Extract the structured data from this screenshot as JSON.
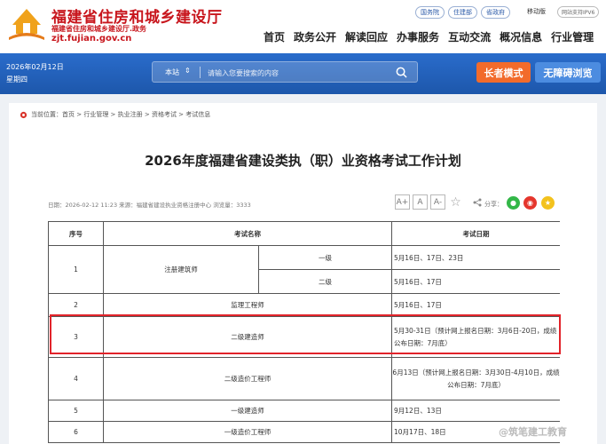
{
  "header": {
    "title": "福建省住房和城乡建设厅",
    "subtitle": "福建省住房和城乡建设厅.政务",
    "domain": "zjt.fujian.gov.cn",
    "top_links": [
      "国务院",
      "住建部",
      "省政府"
    ],
    "mobile": "移动版",
    "ipv6": "网站支持IPV6",
    "nav": [
      "首页",
      "政务公开",
      "解读回应",
      "办事服务",
      "互动交流",
      "概况信息",
      "行业管理"
    ]
  },
  "banner": {
    "date": "2026年02月12日",
    "weekday": "星期四",
    "search_scope": "本站",
    "search_placeholder": "请输入您要搜索的内容",
    "elder_mode": "长者模式",
    "accessible": "无障碍浏览"
  },
  "breadcrumb": "当前位置：首页 > 行业管理 > 执业注册 > 资格考试 > 考试信息",
  "article": {
    "title": "2026年度福建省建设类执（职）业资格考试工作计划",
    "meta": "日期：2026-02-12 11:23    来源：福建省建设执业资格注册中心    浏览量：3333",
    "font_buttons": [
      "A+",
      "A",
      "A-"
    ],
    "share_label": "分享："
  },
  "table": {
    "headers": [
      "序号",
      "考试名称",
      "考试日期"
    ],
    "rows": [
      {
        "no": "1",
        "name": "注册建筑师",
        "sub": "一级",
        "date": "5月16日、17日、23日"
      },
      {
        "no": "",
        "name": "",
        "sub": "二级",
        "date": "5月16日、17日"
      },
      {
        "no": "2",
        "name": "监理工程师",
        "sub": "",
        "date": "5月16日、17日"
      },
      {
        "no": "3",
        "name": "二级建造师",
        "sub": "",
        "date": "5月30-31日（预计网上报名日期：3月6日-20日，成绩公布日期：7月底）"
      },
      {
        "no": "4",
        "name": "二级造价工程师",
        "sub": "",
        "date": "6月13日（预计网上报名日期：3月30日-4月10日，成绩公布日期：7月底）"
      },
      {
        "no": "5",
        "name": "一级建造师",
        "sub": "",
        "date": "9月12日、13日"
      },
      {
        "no": "6",
        "name": "一级造价工程师",
        "sub": "",
        "date": "10月17日、18日"
      }
    ]
  },
  "watermark": "@筑笔建工教育",
  "colors": {
    "brand_red": "#c8161d",
    "banner_blue": "#1f5fb8",
    "elder_orange": "#f26b2b",
    "access_blue": "#4c8ce0",
    "highlight_red": "#e2232a"
  }
}
